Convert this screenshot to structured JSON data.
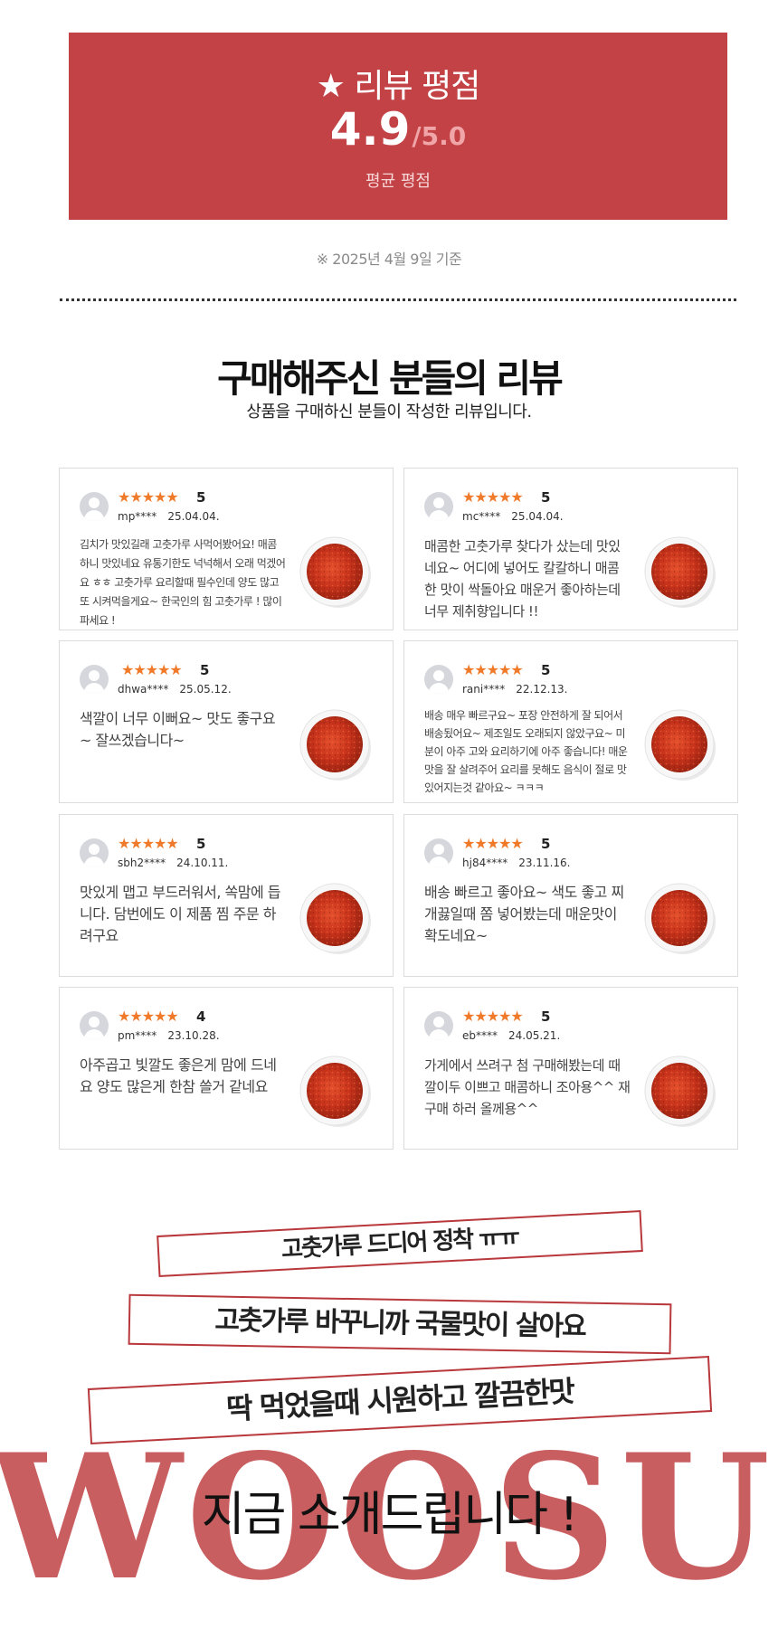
{
  "rating": {
    "title": "★ 리뷰 평점",
    "score": "4.9",
    "max": "/5.0",
    "caption": "평균 평점"
  },
  "basis_note": "※ 2025년 4월 9일 기준",
  "reviews_section": {
    "title": "구매해주신 분들의 리뷰",
    "subtitle": "상품을 구매하신 분들이 작성한 리뷰입니다."
  },
  "reviews": [
    {
      "stars": "★★★★★",
      "score": "5",
      "user": "mp****",
      "date": "25.04.04.",
      "text": "김치가 맛있길래 고춧가루 사먹어봤어요! 매콤하니 맛있네요 유통기한도 넉넉해서 오래 먹겠어요 ㅎㅎ 고춧가루 요리할때 필수인데 양도 많고 또 시켜먹을게요~ 한국인의 힘 고춧가루 ! 많이 파세요 !"
    },
    {
      "stars": "★★★★★",
      "score": "5",
      "user": "mc****",
      "date": "25.04.04.",
      "text": "매콤한 고춧가루 찾다가 샀는데 맛있네요~ 어디에 넣어도 칼칼하니 매콤한 맛이 싹돌아요 매운거 좋아하는데 너무 제취향입니다 !!"
    },
    {
      "stars": "★★★★★",
      "score": "5",
      "user": "dhwa****",
      "date": "25.05.12.",
      "text": "색깔이 너무 이뻐요~ 맛도 좋구요~ 잘쓰겠습니다~"
    },
    {
      "stars": "★★★★★",
      "score": "5",
      "user": "rani****",
      "date": "22.12.13.",
      "text": "배송 매우 빠르구요~ 포장 안전하게 잘 되어서 배송됬어요~ 제조일도 오래되지 않았구요~ 미분이 아주 고와 요리하기에 아주 좋습니다! 매운맛을 잘 살려주어 요리를 못해도 음식이 절로 맛있어지는것 같아요~ ㅋㅋㅋ"
    },
    {
      "stars": "★★★★★",
      "score": "5",
      "user": "sbh2****",
      "date": "24.10.11.",
      "text": "맛있게 맵고 부드러워서, 쏙맘에 듭니다. 담번에도 이 제품 찜 주문 하려구요"
    },
    {
      "stars": "★★★★★",
      "score": "5",
      "user": "hj84****",
      "date": "23.11.16.",
      "text": "배송 빠르고 좋아요~ 색도 좋고 찌개끓일때 쫌 넣어봤는데 매운맛이 확도네요~"
    },
    {
      "stars": "★★★★★",
      "score": "4",
      "user": "pm****",
      "date": "23.10.28.",
      "text": "아주곱고 빛깔도 좋은게 맘에 드네요 양도 많은게 한참 쓸거 같네요"
    },
    {
      "stars": "★★★★★",
      "score": "5",
      "user": "eb****",
      "date": "24.05.21.",
      "text": "가게에서 쓰려구 첨 구매해봤는데 때깔이두 이쁘고 매콤하니 조아용^^ 재구매 하러 올께용^^"
    }
  ],
  "banners": [
    "고춧가루 드디어 정착 ㅠㅠ",
    "고춧가루 바꾸니까 국물맛이 살아요",
    "딱 먹었을때 시원하고 깔끔한맛"
  ],
  "brand_text": "WOOSUNG",
  "intro_text": "지금 소개드립니다 !",
  "colors": {
    "accent_red": "#c24246",
    "star_orange": "#f07a2a",
    "brand_red": "#c95e60"
  }
}
